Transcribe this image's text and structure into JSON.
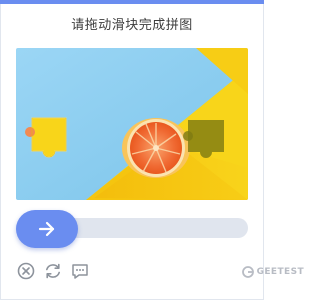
{
  "captcha": {
    "title": "请拖动滑块完成拼图",
    "brand": "GEETEST"
  },
  "icons": {
    "slider": "arrow-right-icon",
    "close": "close-icon",
    "refresh": "refresh-icon",
    "feedback": "feedback-icon",
    "brand_logo": "geetest-logo-icon"
  },
  "colors": {
    "accent": "#6a8df0",
    "track": "#e0e5ee",
    "icon_gray": "#8d939c",
    "sky": "#8fd0f2",
    "yellow": "#f8d51a",
    "orange": "#f46f3c"
  }
}
